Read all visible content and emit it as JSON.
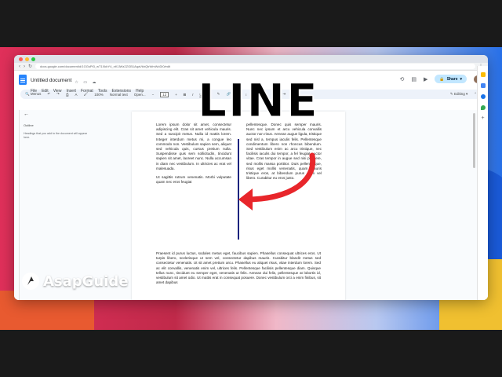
{
  "browser": {
    "url": "docs.google.com/document/d/1GGsPt3_wT1XkbY4_nK1lWz2ZGB1AqaVkhQtrWmWcDl0/edit"
  },
  "doc": {
    "title": "Untitled document",
    "menus": [
      "File",
      "Edit",
      "View",
      "Insert",
      "Format",
      "Tools",
      "Extensions",
      "Help"
    ],
    "share_label": "Share"
  },
  "toolbar": {
    "search": "Menus",
    "zoom": "100%",
    "style": "Normal text",
    "font": "Open...",
    "font_size": "12",
    "mode": "Editing"
  },
  "outline": {
    "label": "Outline",
    "hint": "Headings that you add to the document will appear here."
  },
  "content": {
    "left_p1": "Lorem ipsum dolor sit amet, consectetur adipiscing elit. Cras sit amet vehicula mauris. Sed a suscipit metus. Nulla id mattis lorem. Integer interdum metus mi, a congue leo commodo non. Vestibulum sapien sem, aliquet sed vehicula quis, cursus pretium nulla. Suspendisse quis sem sollicitudin, tincidunt sapien sit amet, laoreet nunc. Nulla accumsan in diam nec vestibulum. In ultricies ac erat vel malesuada.",
    "left_p2": "Ut sagittis rutrum venenatis. Morbi vulputate quam nec eros feugiat",
    "right_p1": "pellentesque. Donec quis semper mauris. Nunc nec ipsum et arcu vehicula convallis auctor non risus. Aenean augue ligula, tristique sed nisl a, tempus iaculis felis. Pellentesque condimentum libero non rhoncus bibendum. Sed vestibulum enim ac arcu tristique, nec facilisis iaculis dui tempor, a fel feugiat auctor vitae. Cras tempor in augue sed nisi posuere, sed mollis massa porttitor. Duis pellentesque, risus eget mollis venenatis, quam mauris tristique eros, at bibendum purus diam vel libero. Curabitur eu eros justo.",
    "full_p": "Praesent id purus luctus, sodales metus eget, faucibus sapien. Phasellus consequat ultrices eros. Ut turpis libero, scelerisque ut sem vel, consectetur dapibus mauris. Curabitur blandit metus sed consectetur venenatis. Ut sit amet pretium arcu. Phasellus eu aliquet risus, vitae interdum lorem. Sed ac elit convallis, venenatis enim vel, ultrices felis. Pellentesque facilisis pellentesque diam. Quisque tellus nunc, tincidunt eu semper eget, venenatis ut felis. Aenean dui felis, pellentesque at lobortis id, vestibulum sit amet odio. Ut mattis erat in consequat posuere. Donec vestibulum orci a enim finibus, sit amet dapibus"
  },
  "overlay": {
    "title": "LINE",
    "brand": "AsapGuide"
  },
  "colors": {
    "accent_red": "#e8262b",
    "divider_line": "#1a237e",
    "share_bg": "#c2e7ff"
  }
}
